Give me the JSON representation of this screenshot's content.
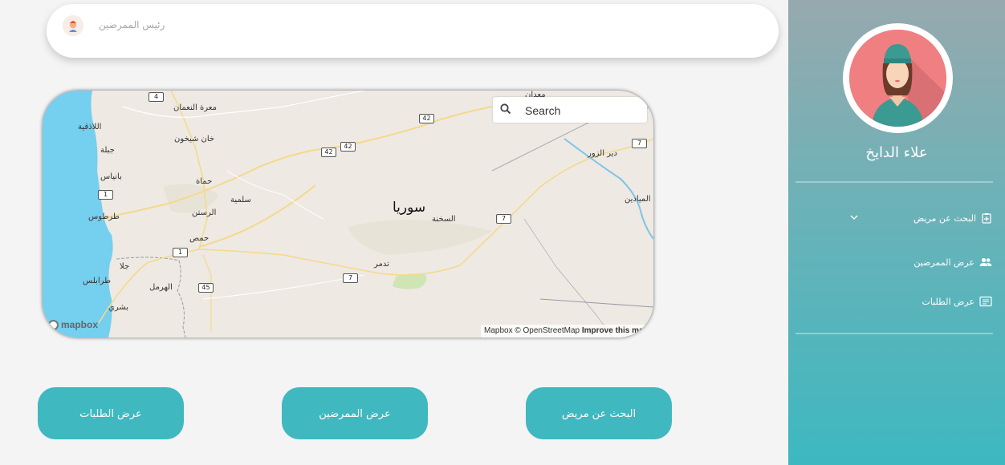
{
  "header": {
    "role_label": "رئيس الممرضين"
  },
  "map": {
    "search_placeholder": "Search",
    "logo_text": "mapbox",
    "attribution": "Mapbox © OpenStreetMap",
    "attribution_link": "Improve this map",
    "country_label": "سوريا",
    "places": {
      "latakia": "اللاذقية",
      "jableh": "جبلة",
      "baniyas": "بانياس",
      "tartus": "طرطوس",
      "tripoli": "طرابلس",
      "hermel": "الهرمل",
      "bsharri": "بشري",
      "hama": "حماة",
      "homs": "حمص",
      "rastan": "الرستن",
      "salamiyah": "سلمية",
      "maarat": "معرة النعمان",
      "khan": "خان شيخون",
      "palmyra": "تدمر",
      "sukhnah": "السخنة",
      "deir": "دير الزور",
      "mayadin": "الميادين",
      "maadan": "معدان",
      "jala": "جلا"
    },
    "road_shields": [
      "4",
      "42",
      "42",
      "42",
      "7",
      "7",
      "7",
      "1",
      "1",
      "45"
    ]
  },
  "buttons": {
    "requests": "عرض الطلبات",
    "nurses": "عرض الممرضين",
    "search_patient": "البحث عن مريض"
  },
  "sidebar": {
    "user_name": "علاء الدايخ",
    "items": [
      {
        "label": "البحث عن مريض",
        "icon": "clipboard-plus-icon",
        "has_submenu": true
      },
      {
        "label": "عرض الممرضين",
        "icon": "people-icon"
      },
      {
        "label": "عرض الطلبات",
        "icon": "list-icon"
      }
    ]
  },
  "colors": {
    "accent": "#3fb8c0",
    "sea": "#75cfee",
    "land": "#eee9e2",
    "profile_bg": "#f07f82"
  }
}
